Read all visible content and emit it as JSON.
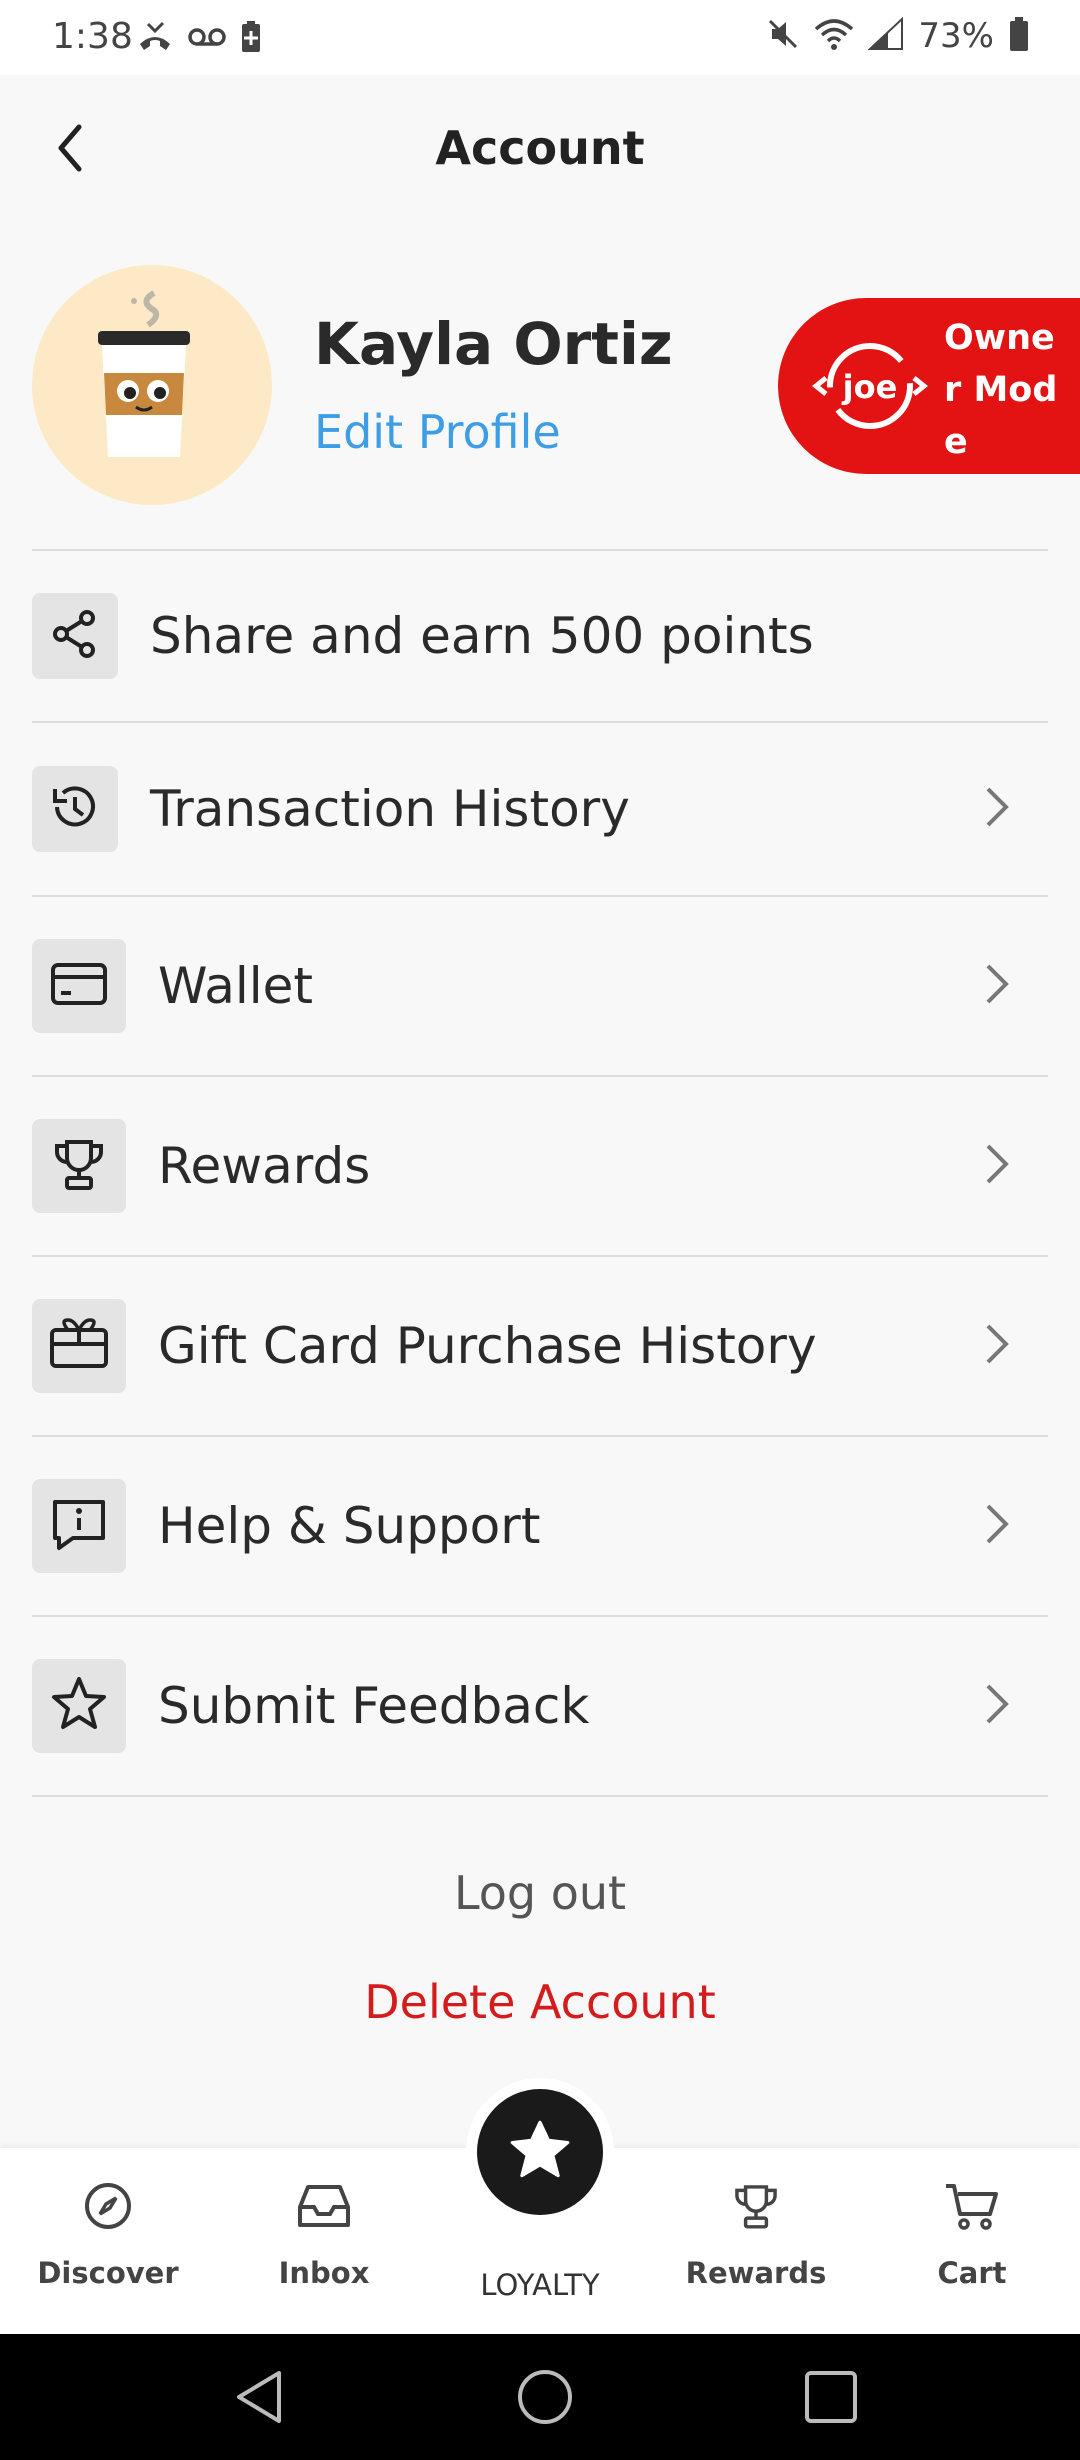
{
  "status_bar": {
    "time": "1:38",
    "battery_percent": "73%",
    "icons": [
      "missed-call-icon",
      "voicemail-icon",
      "battery-saver-icon",
      "mute-icon",
      "wifi-icon",
      "signal-icon",
      "battery-icon"
    ]
  },
  "header": {
    "title": "Account",
    "back_icon": "chevron-left-icon"
  },
  "profile": {
    "name": "Kayla Ortiz",
    "edit_label": "Edit Profile",
    "avatar_icon": "coffee-cup-avatar"
  },
  "owner_mode": {
    "logo_text": "joe",
    "label": "Owner Mode",
    "color": "#e31313"
  },
  "menu": {
    "items": [
      {
        "label": "Share and earn 500 points",
        "icon": "share-icon",
        "has_chevron": false
      },
      {
        "label": "Transaction History",
        "icon": "history-icon",
        "has_chevron": true
      },
      {
        "label": "Wallet",
        "icon": "wallet-card-icon",
        "has_chevron": true
      },
      {
        "label": "Rewards",
        "icon": "trophy-icon",
        "has_chevron": true
      },
      {
        "label": "Gift Card Purchase History",
        "icon": "gift-card-icon",
        "has_chevron": true
      },
      {
        "label": "Help & Support",
        "icon": "info-chat-icon",
        "has_chevron": true
      },
      {
        "label": "Submit Feedback",
        "icon": "star-outline-icon",
        "has_chevron": true
      }
    ]
  },
  "actions": {
    "logout": "Log out",
    "delete_account": "Delete Account",
    "delete_color": "#d41c1c"
  },
  "bottom_nav": {
    "items": [
      {
        "label": "Discover",
        "icon": "compass-icon"
      },
      {
        "label": "Inbox",
        "icon": "inbox-icon"
      },
      {
        "label": "LOYALTY",
        "icon": "star-badge-icon"
      },
      {
        "label": "Rewards",
        "icon": "trophy-icon"
      },
      {
        "label": "Cart",
        "icon": "cart-icon"
      }
    ]
  },
  "colors": {
    "accent_link": "#3d9ee6",
    "background": "#f8f8f8"
  }
}
